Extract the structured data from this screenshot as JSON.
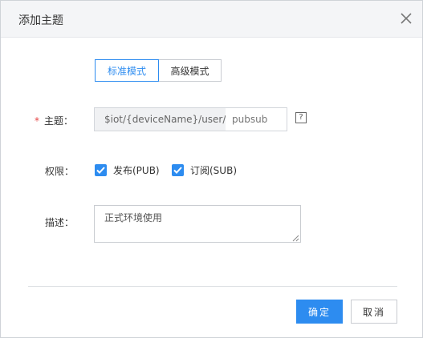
{
  "dialog": {
    "title": "添加主题",
    "close_icon": "close-icon"
  },
  "mode": {
    "options": [
      {
        "label": "标准模式",
        "active": true
      },
      {
        "label": "高级模式",
        "active": false
      }
    ]
  },
  "topic": {
    "label": "主题：",
    "required_mark": "*",
    "prefix": "$iot/{deviceName}/user/",
    "placeholder": "pubsub",
    "value": "",
    "help_icon": "question-icon",
    "help_glyph": "?"
  },
  "permission": {
    "label": "权限：",
    "options": [
      {
        "label": "发布(PUB)",
        "checked": true
      },
      {
        "label": "订阅(SUB)",
        "checked": true
      }
    ]
  },
  "description": {
    "label": "描述：",
    "value": "正式环境使用"
  },
  "footer": {
    "ok_label": "确定",
    "cancel_label": "取消"
  },
  "colors": {
    "primary": "#2d8cf0",
    "required": "#e64545"
  }
}
